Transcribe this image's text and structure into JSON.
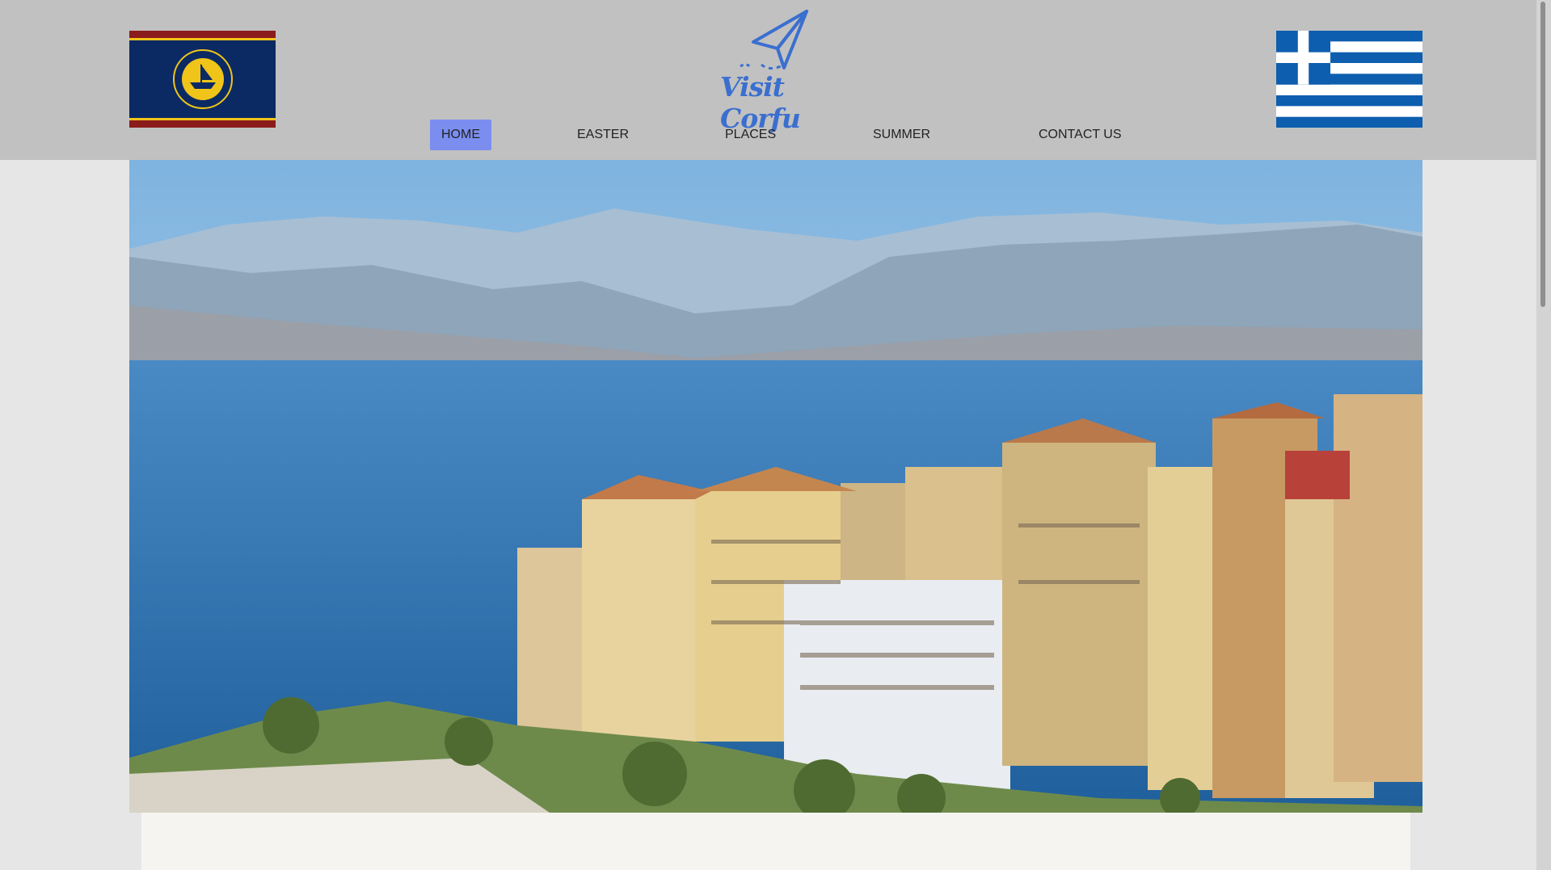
{
  "header": {
    "brand": "Visit Corfu",
    "left_emblem": "municipality-flag-icon",
    "right_emblem": "greek-flag-icon"
  },
  "nav": {
    "items": [
      {
        "label": "HOME",
        "active": true
      },
      {
        "label": "EASTER",
        "active": false
      },
      {
        "label": "PLACES",
        "active": false
      },
      {
        "label": "SUMMER",
        "active": false
      },
      {
        "label": "CONTACT US",
        "active": false
      }
    ]
  },
  "colors": {
    "header_bg": "#c1c1c1",
    "nav_active": "#7b8ef0",
    "brand_blue": "#3a6fcf",
    "greek_blue": "#0d5eaf"
  },
  "hero": {
    "image": "corfu-old-town-seafront-photo"
  }
}
